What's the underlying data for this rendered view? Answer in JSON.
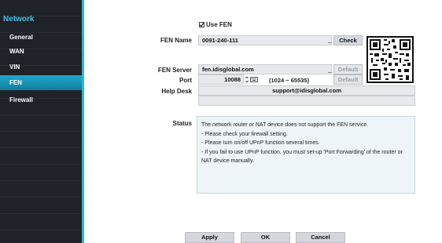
{
  "sidebar": {
    "title": "Network",
    "items": [
      {
        "label": "General"
      },
      {
        "label": "WAN"
      },
      {
        "label": "VIN"
      },
      {
        "label": "FEN"
      },
      {
        "label": "Firewall"
      }
    ],
    "accent_color": "#29b7d6",
    "active_color": "#1a9bbd"
  },
  "fen": {
    "use_fen_label": "Use FEN",
    "use_fen_checked": true,
    "fen_name_label": "FEN Name",
    "fen_name_value": "0091-240-111",
    "check_label": "Check",
    "fen_server_label": "FEN Server",
    "fen_server_value": "fen.idisglobal.com",
    "default_label": "Default",
    "port_label": "Port",
    "port_value": "10088",
    "port_range": "(1024 ~ 65535)",
    "help_desk_label": "Help Desk",
    "help_desk_value": "support@idisglobal.com",
    "status_label": "Status",
    "status_lines": [
      "The network router or NAT device does not support the FEN service.",
      "- Please check your firewall setting.",
      "- Please turn on/off UPnP function several times.",
      "- If you fail to use UPnP function, you must set-up 'Port Forwarding' of the router or",
      "NAT device manually."
    ]
  },
  "footer": {
    "apply_label": "Apply",
    "ok_label": "OK",
    "cancel_label": "Cancel"
  },
  "icons": {
    "qr": "qr-code-icon",
    "keyboard": "keyboard-icon",
    "spinner": "spinner-arrows-icon",
    "checkbox": "checkbox-icon"
  }
}
